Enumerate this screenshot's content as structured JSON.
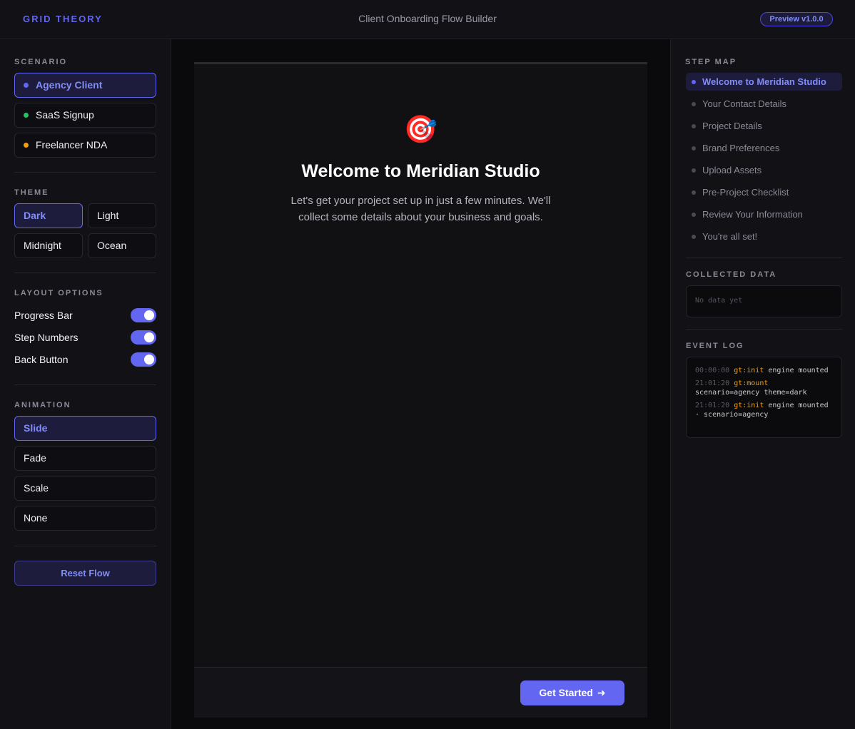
{
  "header": {
    "brand": "GRID THEORY",
    "title": "Client Onboarding Flow Builder",
    "badge": "Preview v1.0.0"
  },
  "sidebar": {
    "scenario_label": "SCENARIO",
    "scenarios": [
      {
        "label": "Agency Client",
        "color": "#6366f1",
        "active": true
      },
      {
        "label": "SaaS Signup",
        "color": "#22c55e",
        "active": false
      },
      {
        "label": "Freelancer NDA",
        "color": "#f59e0b",
        "active": false
      }
    ],
    "theme_label": "THEME",
    "themes": [
      "Dark",
      "Light",
      "Midnight",
      "Ocean"
    ],
    "active_theme": "Dark",
    "layout_label": "LAYOUT OPTIONS",
    "toggles": [
      {
        "label": "Progress Bar",
        "on": true
      },
      {
        "label": "Step Numbers",
        "on": true
      },
      {
        "label": "Back Button",
        "on": true
      }
    ],
    "animation_label": "ANIMATION",
    "animations": [
      "Slide",
      "Fade",
      "Scale",
      "None"
    ],
    "active_animation": "Slide",
    "reset_label": "Reset Flow"
  },
  "stage": {
    "emoji": "🎯",
    "title": "Welcome to Meridian Studio",
    "description": "Let's get your project set up in just a few minutes. We'll collect some details about your business and goals.",
    "cta_label": "Get Started",
    "cta_icon": "arrow-right-icon"
  },
  "right": {
    "step_map_label": "STEP MAP",
    "steps": [
      "Welcome to Meridian Studio",
      "Your Contact Details",
      "Project Details",
      "Brand Preferences",
      "Upload Assets",
      "Pre-Project Checklist",
      "Review Your Information",
      "You're all set!"
    ],
    "active_step": 0,
    "collected_label": "COLLECTED DATA",
    "collected_empty": "No data yet",
    "event_log_label": "EVENT LOG",
    "events": [
      {
        "time": "00:00:00",
        "tag": "gt:init",
        "text": "engine mounted"
      },
      {
        "time": "21:01:20",
        "tag": "gt:mount",
        "text": "scenario=agency theme=dark"
      },
      {
        "time": "21:01:20",
        "tag": "gt:init",
        "text": "engine mounted · scenario=agency"
      }
    ]
  },
  "colors": {
    "accent": "#6366f1",
    "accent_text": "#818cf8",
    "log_tag": "#f59e0b"
  }
}
